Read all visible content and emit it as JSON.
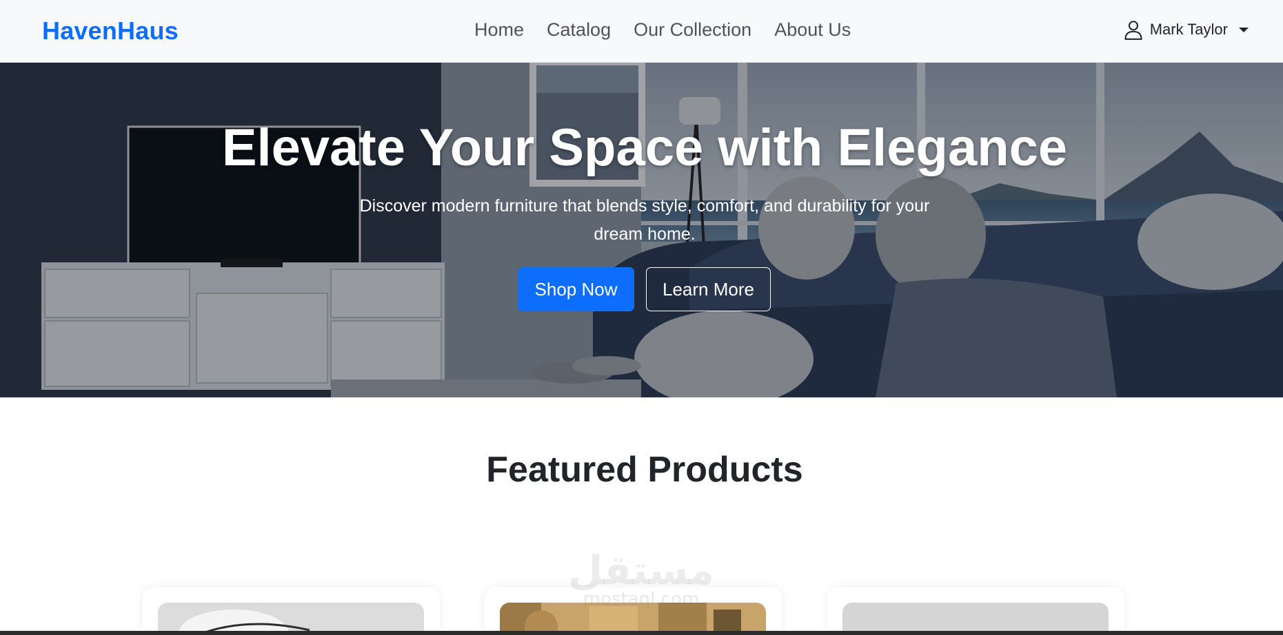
{
  "navbar": {
    "brand": "HavenHaus",
    "links": [
      "Home",
      "Catalog",
      "Our Collection",
      "About Us"
    ],
    "user_name": "Mark Taylor"
  },
  "hero": {
    "title": "Elevate Your Space with Elegance",
    "subtitle_line1": "Discover modern furniture that blends style, comfort, and durability for your",
    "subtitle_line2": "dream home.",
    "primary_button": "Shop Now",
    "secondary_button": "Learn More"
  },
  "featured": {
    "title": "Featured Products",
    "cards": [
      {
        "image": "white-chair-photo"
      },
      {
        "image": "wooden-decor-photo"
      },
      {
        "image": "wooden-stool-photo"
      }
    ]
  },
  "watermark": {
    "main": "مستقل",
    "sub": "mostaql.com"
  },
  "colors": {
    "brand": "#0d6efd",
    "navbar_bg": "#f8f9fa",
    "primary_button": "#0d6efd"
  }
}
